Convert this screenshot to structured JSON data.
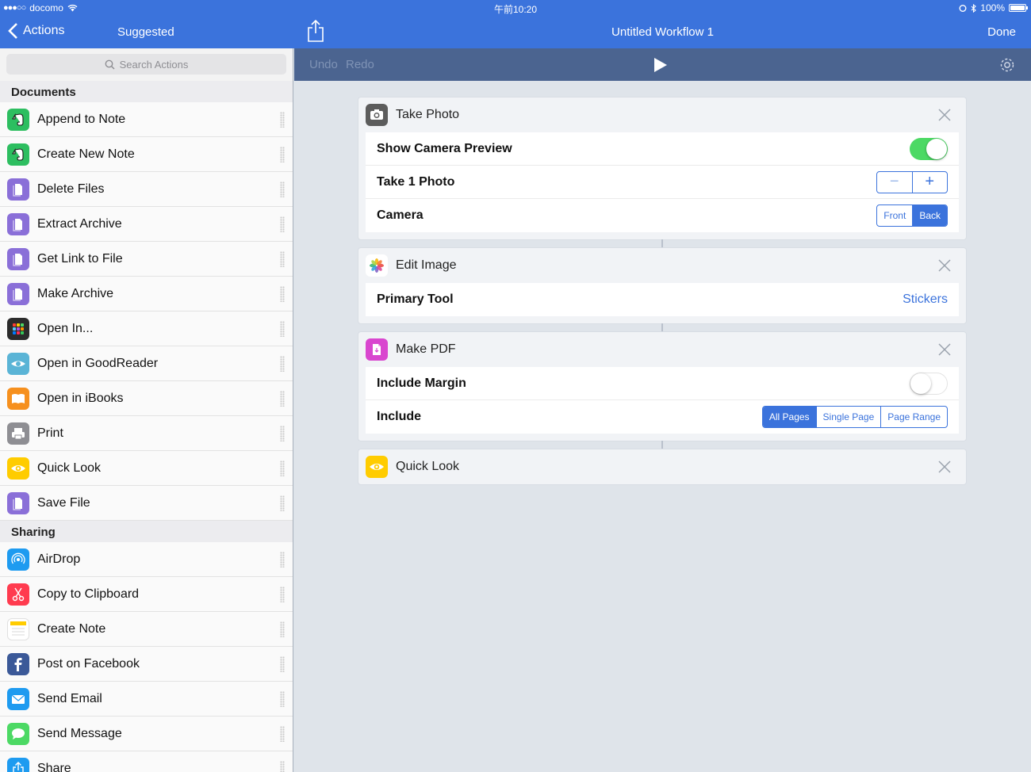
{
  "status": {
    "carrier": "docomo",
    "time": "午前10:20",
    "battery": "100%"
  },
  "nav": {
    "back_label": "Actions",
    "suggested_label": "Suggested",
    "workflow_title": "Untitled Workflow 1",
    "done_label": "Done"
  },
  "toolbar": {
    "undo": "Undo",
    "redo": "Redo"
  },
  "search": {
    "placeholder": "Search Actions"
  },
  "sections": [
    {
      "title": "Documents",
      "items": [
        {
          "label": "Append to Note",
          "icon": "evernote-icon",
          "color": "#2dbe60"
        },
        {
          "label": "Create New Note",
          "icon": "evernote-icon",
          "color": "#2dbe60"
        },
        {
          "label": "Delete Files",
          "icon": "document-icon",
          "color": "#8a6fd8"
        },
        {
          "label": "Extract Archive",
          "icon": "document-icon",
          "color": "#8a6fd8"
        },
        {
          "label": "Get Link to File",
          "icon": "document-icon",
          "color": "#8a6fd8"
        },
        {
          "label": "Make Archive",
          "icon": "document-icon",
          "color": "#8a6fd8"
        },
        {
          "label": "Open In...",
          "icon": "apps-grid-icon",
          "color": "#2b2b2b"
        },
        {
          "label": "Open in GoodReader",
          "icon": "goodreader-eye-icon",
          "color": "#5ab4d6"
        },
        {
          "label": "Open in iBooks",
          "icon": "book-icon",
          "color": "#f6901e"
        },
        {
          "label": "Print",
          "icon": "printer-icon",
          "color": "#8e8e93"
        },
        {
          "label": "Quick Look",
          "icon": "eye-icon",
          "color": "#ffcc00"
        },
        {
          "label": "Save File",
          "icon": "document-icon",
          "color": "#8a6fd8"
        }
      ]
    },
    {
      "title": "Sharing",
      "items": [
        {
          "label": "AirDrop",
          "icon": "airdrop-icon",
          "color": "#1e9bf0"
        },
        {
          "label": "Copy to Clipboard",
          "icon": "scissors-icon",
          "color": "#ff3b4f"
        },
        {
          "label": "Create Note",
          "icon": "notes-icon",
          "color": "#ffffff"
        },
        {
          "label": "Post on Facebook",
          "icon": "facebook-icon",
          "color": "#3b5998"
        },
        {
          "label": "Send Email",
          "icon": "mail-icon",
          "color": "#1e9bf0"
        },
        {
          "label": "Send Message",
          "icon": "message-icon",
          "color": "#4cd964"
        },
        {
          "label": "Share",
          "icon": "share-icon",
          "color": "#1e9bf0"
        }
      ]
    }
  ],
  "workflow": {
    "take_photo": {
      "title": "Take Photo",
      "show_preview_label": "Show Camera Preview",
      "show_preview_on": true,
      "count_label": "Take 1 Photo",
      "camera_label": "Camera",
      "camera_options": [
        "Front",
        "Back"
      ],
      "camera_selected": "Back"
    },
    "edit_image": {
      "title": "Edit Image",
      "tool_label": "Primary Tool",
      "tool_value": "Stickers"
    },
    "make_pdf": {
      "title": "Make PDF",
      "margin_label": "Include Margin",
      "margin_on": false,
      "include_label": "Include",
      "include_options": [
        "All Pages",
        "Single Page",
        "Page Range"
      ],
      "include_selected": "All Pages"
    },
    "quick_look": {
      "title": "Quick Look"
    }
  },
  "colors": {
    "accent": "#3b73dc",
    "toggle_on": "#4cd964"
  }
}
